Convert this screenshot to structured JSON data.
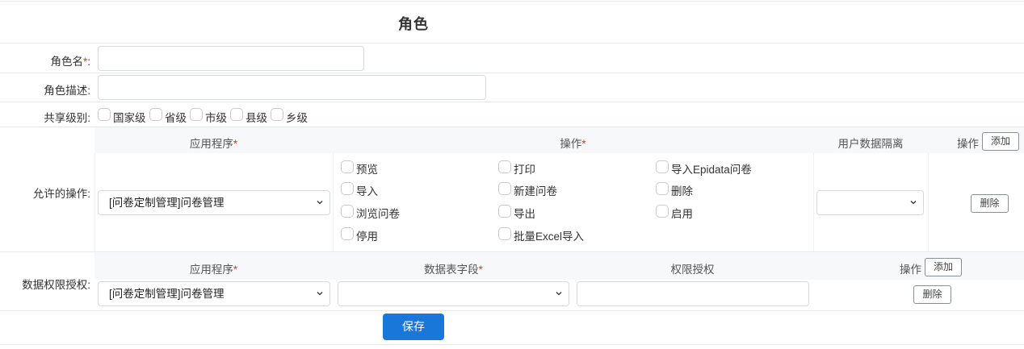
{
  "page": {
    "title": "角色"
  },
  "form": {
    "role_name": {
      "label": "角色名",
      "required_mark": "*",
      "suffix": ":",
      "value": ""
    },
    "role_desc": {
      "label": "角色描述:",
      "value": ""
    },
    "share_level": {
      "label": "共享级别:",
      "options": [
        "国家级",
        "省级",
        "市级",
        "县级",
        "乡级"
      ]
    },
    "allowed_ops": {
      "label": "允许的操作:",
      "headers": {
        "app": "应用程序",
        "ops": "操作",
        "isolation": "用户数据隔离",
        "action": "操作",
        "req": "*"
      },
      "add_label": "添加",
      "delete_label": "删除",
      "app_value": "[问卷定制管理]问卷管理",
      "isolation_value": "",
      "ops": [
        [
          "预览",
          "打印",
          "导入Epidata问卷"
        ],
        [
          "导入",
          "新建问卷",
          "删除"
        ],
        [
          "浏览问卷",
          "导出",
          "启用"
        ],
        [
          "停用",
          "批量Excel导入",
          ""
        ]
      ]
    },
    "data_perm": {
      "label": "数据权限授权:",
      "headers": {
        "app": "应用程序",
        "field": "数据表字段",
        "grant": "权限授权",
        "action": "操作",
        "req": "*"
      },
      "add_label": "添加",
      "delete_label": "删除",
      "app_value": "[问卷定制管理]问卷管理",
      "field_value": "",
      "grant_value": ""
    },
    "save_label": "保存"
  },
  "colors": {
    "accent": "#1877d8",
    "required": "#e0312f",
    "header_bg": "#f7f8fa"
  },
  "icons": {
    "select": "chevron-down-icon"
  }
}
